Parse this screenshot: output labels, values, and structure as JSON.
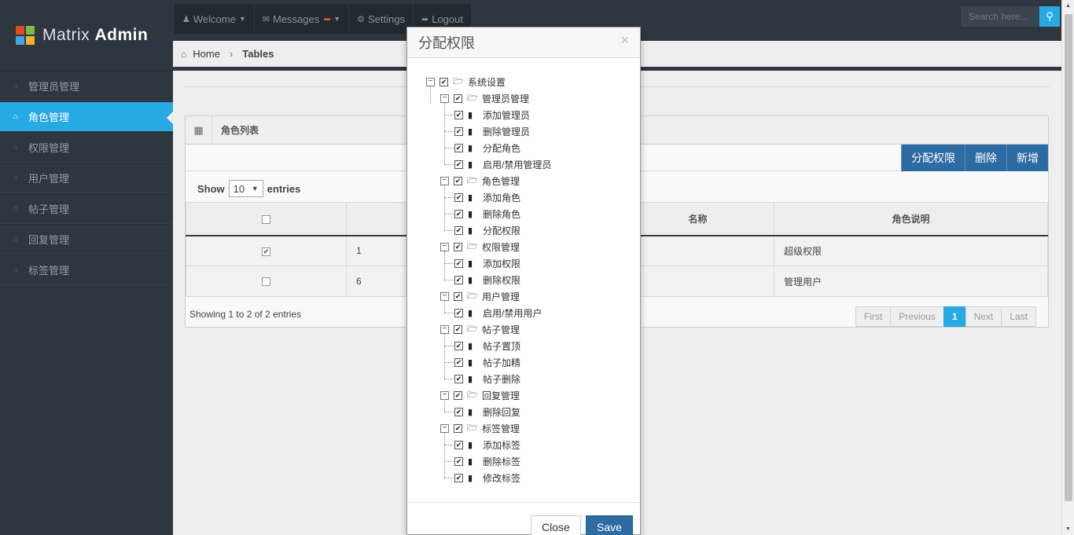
{
  "app": {
    "brand_light": "Matrix ",
    "brand_bold": "Admin"
  },
  "topnav": {
    "welcome": "Welcome",
    "messages": "Messages",
    "settings": "Settings",
    "logout": "Logout",
    "search_placeholder": "Search here..."
  },
  "breadcrumb": {
    "home": "Home",
    "current": "Tables"
  },
  "sidebar": {
    "items": [
      {
        "label": "管理员管理"
      },
      {
        "label": "角色管理"
      },
      {
        "label": "权限管理"
      },
      {
        "label": "用户管理"
      },
      {
        "label": "帖子管理"
      },
      {
        "label": "回复管理"
      },
      {
        "label": "标签管理"
      }
    ]
  },
  "widget": {
    "title": "角色列表",
    "buttons": {
      "assign": "分配权限",
      "delete": "删除",
      "add": "新增"
    },
    "show": "Show",
    "entries_value": "10",
    "entries": "entries",
    "columns": [
      "",
      "",
      "名称",
      "角色说明"
    ],
    "rows": [
      {
        "checked": true,
        "id": "1",
        "desc": "超级权限"
      },
      {
        "checked": false,
        "id": "6",
        "desc": "管理用户"
      }
    ],
    "info": "Showing 1 to 2 of 2 entries",
    "pager": {
      "first": "First",
      "previous": "Previous",
      "page": "1",
      "next": "Next",
      "last": "Last"
    }
  },
  "modal": {
    "title": "分配权限",
    "close_x": "×",
    "tree": {
      "root": "系统设置",
      "groups": [
        {
          "label": "管理员管理",
          "children": [
            "添加管理员",
            "删除管理员",
            "分配角色",
            "启用/禁用管理员"
          ]
        },
        {
          "label": "角色管理",
          "children": [
            "添加角色",
            "删除角色",
            "分配权限"
          ]
        },
        {
          "label": "权限管理",
          "children": [
            "添加权限",
            "删除权限"
          ]
        },
        {
          "label": "用户管理",
          "children": [
            "启用/禁用用户"
          ]
        },
        {
          "label": "帖子管理",
          "children": [
            "帖子置顶",
            "帖子加精",
            "帖子删除"
          ]
        },
        {
          "label": "回复管理",
          "children": [
            "删除回复"
          ]
        },
        {
          "label": "标签管理",
          "children": [
            "添加标签",
            "删除标签",
            "修改标签"
          ]
        }
      ]
    },
    "close_button": "Close",
    "save_button": "Save"
  },
  "colors": {
    "accent": "#27a9e3",
    "primary_button": "#2d6ba3",
    "sidebar": "#2e363f"
  }
}
